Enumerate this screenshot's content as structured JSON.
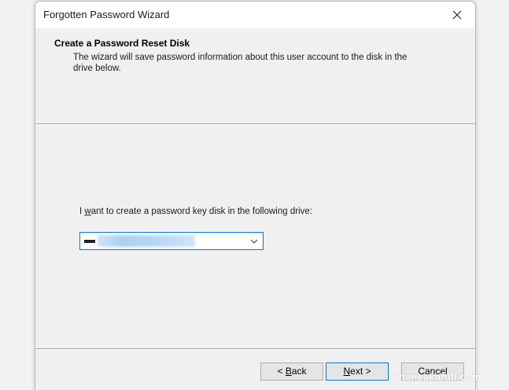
{
  "window": {
    "title": "Forgotten Password Wizard"
  },
  "header": {
    "title": "Create a Password Reset Disk",
    "description": "The wizard will save password information about this user account to the disk in the drive below."
  },
  "main": {
    "drive_label_prefix": "I ",
    "drive_label_accel": "w",
    "drive_label_suffix": "ant to create a password key disk in the following drive:",
    "drive_select": {
      "selected_value": "",
      "icon": "drive-icon"
    }
  },
  "buttons": {
    "back_prefix": "< ",
    "back_accel": "B",
    "back_suffix": "ack",
    "next_accel": "N",
    "next_suffix": "ext >",
    "cancel": "Cancel"
  },
  "watermark": "Shaneakafull.com",
  "colors": {
    "accent": "#0078d7",
    "window_bg": "#f0f0f0",
    "titlebar_bg": "#ffffff"
  }
}
